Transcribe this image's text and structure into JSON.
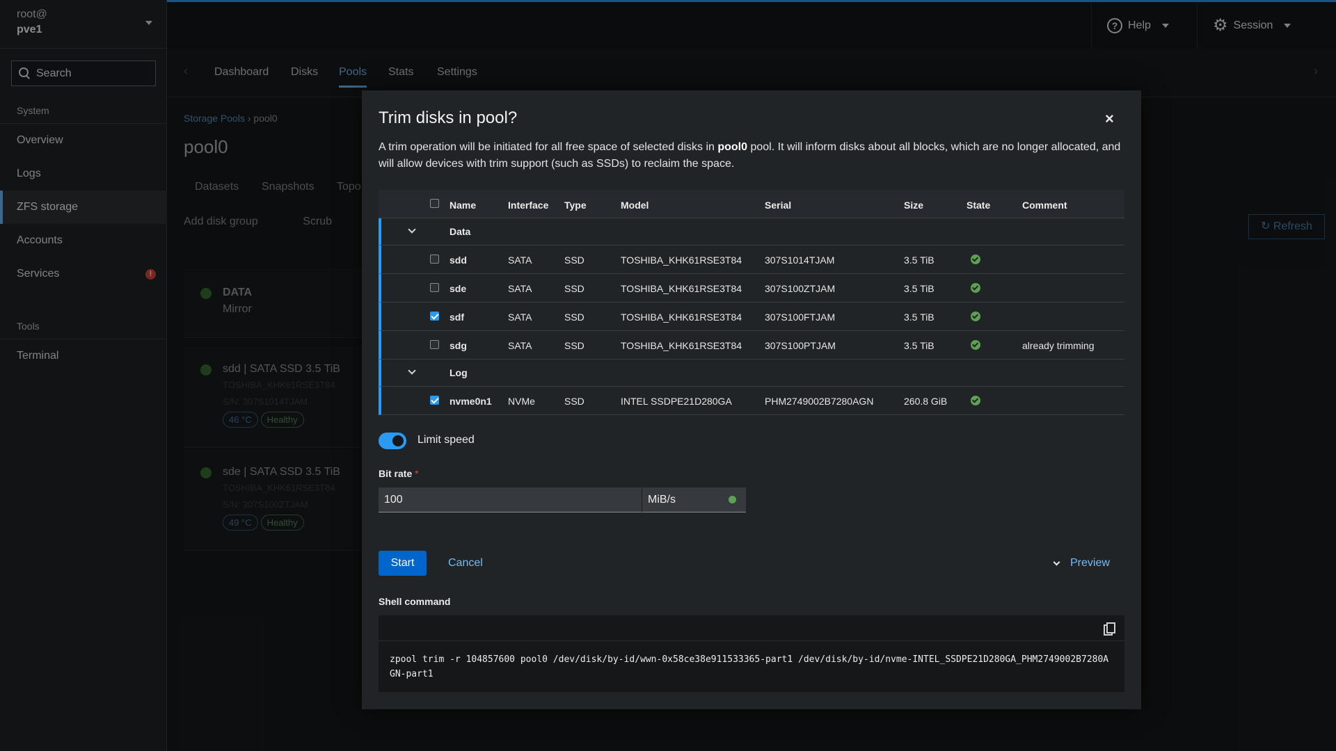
{
  "sidebar": {
    "user_host": "root@",
    "host_name": "pve1",
    "search_placeholder": "Search",
    "section_system": "System",
    "items": [
      {
        "label": "Overview"
      },
      {
        "label": "Logs"
      },
      {
        "label": "ZFS storage"
      },
      {
        "label": "Accounts"
      },
      {
        "label": "Services"
      }
    ],
    "section_tools": "Tools",
    "tools_items": [
      {
        "label": "Terminal"
      }
    ],
    "services_badge": "!"
  },
  "topbar": {
    "help_label": "Help",
    "session_label": "Session"
  },
  "main": {
    "tabs": [
      {
        "label": "Dashboard"
      },
      {
        "label": "Disks"
      },
      {
        "label": "Pools"
      },
      {
        "label": "Stats"
      },
      {
        "label": "Settings"
      }
    ],
    "breadcrumb_root": "Storage Pools",
    "breadcrumb_current": "pool0",
    "page_title": "pool0",
    "subtabs": [
      {
        "label": "Datasets"
      },
      {
        "label": "Snapshots"
      },
      {
        "label": "Topo"
      }
    ],
    "toolbar": {
      "add_disk_group": "Add disk group",
      "scrub": "Scrub",
      "refresh": "Refresh"
    },
    "cards": [
      {
        "title": "DATA",
        "subtitle": "Mirror"
      },
      {
        "title": "sdd | SATA SSD 3.5 TiB",
        "model": "TOSHIBA_KHK61RSE3T84",
        "serial": "S/N: 307S1014TJAM",
        "temp": "46 °C",
        "health": "Healthy"
      },
      {
        "title": "sde | SATA SSD 3.5 TiB",
        "model": "TOSHIBA_KHK61RSE3T84",
        "serial": "S/N: 307S100ZTJAM",
        "temp": "49 °C",
        "health": "Healthy"
      }
    ]
  },
  "modal": {
    "title": "Trim disks in pool?",
    "close": "×",
    "desc_before": "A trim operation will be initiated for all free space of selected disks in ",
    "desc_pool": "pool0",
    "desc_after": " pool. It will inform disks about all blocks, which are no longer allocated, and will allow devices with trim support (such as SSDs) to reclaim the space.",
    "table": {
      "headers": {
        "name": "Name",
        "interface": "Interface",
        "type": "Type",
        "model": "Model",
        "serial": "Serial",
        "size": "Size",
        "state": "State",
        "comment": "Comment"
      },
      "group_data": "Data",
      "group_log": "Log",
      "rows": [
        {
          "name": "sdd",
          "interface": "SATA",
          "type": "SSD",
          "model": "TOSHIBA_KHK61RSE3T84",
          "serial": "307S1014TJAM",
          "size": "3.5 TiB",
          "comment": "",
          "checked": false
        },
        {
          "name": "sde",
          "interface": "SATA",
          "type": "SSD",
          "model": "TOSHIBA_KHK61RSE3T84",
          "serial": "307S100ZTJAM",
          "size": "3.5 TiB",
          "comment": "",
          "checked": false
        },
        {
          "name": "sdf",
          "interface": "SATA",
          "type": "SSD",
          "model": "TOSHIBA_KHK61RSE3T84",
          "serial": "307S100FTJAM",
          "size": "3.5 TiB",
          "comment": "",
          "checked": true
        },
        {
          "name": "sdg",
          "interface": "SATA",
          "type": "SSD",
          "model": "TOSHIBA_KHK61RSE3T84",
          "serial": "307S100PTJAM",
          "size": "3.5 TiB",
          "comment": "already trimming",
          "checked": false
        }
      ],
      "log_rows": [
        {
          "name": "nvme0n1",
          "interface": "NVMe",
          "type": "SSD",
          "model": "INTEL SSDPE21D280GA",
          "serial": "PHM2749002B7280AGN",
          "size": "260.8 GiB",
          "comment": "",
          "checked": true
        }
      ]
    },
    "limit_speed_label": "Limit speed",
    "limit_speed_on": true,
    "bit_rate_label": "Bit rate",
    "bit_rate_required": "*",
    "bit_rate_value": "100",
    "bit_rate_unit": "MiB/s",
    "start_label": "Start",
    "cancel_label": "Cancel",
    "preview_label": "Preview",
    "shell_label": "Shell command",
    "shell_command": "zpool trim -r 104857600 pool0 /dev/disk/by-id/wwn-0x58ce38e911533365-part1 /dev/disk/by-id/nvme-INTEL_SSDPE21D280GA_PHM2749002B7280AGN-part1"
  },
  "colors": {
    "accent": "#2b9af3",
    "primary_button": "#0066cc",
    "link": "#73bcf7",
    "success": "#5ba352",
    "danger": "#e0483c"
  }
}
